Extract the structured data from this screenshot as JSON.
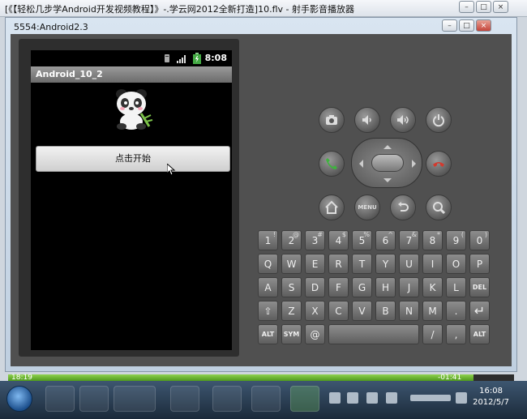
{
  "player": {
    "title": "[《【轻松几步学Android开发视频教程】》-.学云网2012全新打造]10.flv - 射手影音播放器",
    "elapsed": "18:19",
    "remaining": "-01:41",
    "progress": 0.92
  },
  "emulator": {
    "window_title": "5554:Android2.3"
  },
  "device": {
    "clock": "8:08",
    "app_title": "Android_10_2",
    "start_button_label": "点击开始"
  },
  "hardware_buttons": {
    "menu_label": "MENU"
  },
  "keyboard": {
    "rows": [
      [
        {
          "k": "Q",
          "a": "1"
        },
        {
          "k": "W",
          "a": "2"
        },
        {
          "k": "E",
          "a": "3"
        },
        {
          "k": "R",
          "a": "4"
        },
        {
          "k": "T",
          "a": "5"
        },
        {
          "k": "Y",
          "a": "6"
        },
        {
          "k": "U",
          "a": "7"
        },
        {
          "k": "I",
          "a": "8"
        },
        {
          "k": "O",
          "a": "9"
        },
        {
          "k": "P",
          "a": "0"
        }
      ],
      [
        {
          "k": "A",
          "a": ""
        },
        {
          "k": "S",
          "a": ""
        },
        {
          "k": "D",
          "a": ""
        },
        {
          "k": "F",
          "a": ""
        },
        {
          "k": "G",
          "a": ""
        },
        {
          "k": "H",
          "a": ""
        },
        {
          "k": "J",
          "a": ""
        },
        {
          "k": "K",
          "a": ""
        },
        {
          "k": "L",
          "a": ""
        },
        {
          "k": "DEL",
          "a": ""
        }
      ],
      [
        {
          "k": "⇧",
          "a": ""
        },
        {
          "k": "Z",
          "a": ""
        },
        {
          "k": "X",
          "a": ""
        },
        {
          "k": "C",
          "a": ""
        },
        {
          "k": "V",
          "a": ""
        },
        {
          "k": "B",
          "a": ""
        },
        {
          "k": "N",
          "a": ""
        },
        {
          "k": "M",
          "a": ""
        },
        {
          "k": ".",
          "a": ""
        },
        {
          "k": "↵",
          "a": ""
        }
      ],
      [
        {
          "k": "ALT",
          "a": ""
        },
        {
          "k": "SYM",
          "a": ""
        },
        {
          "k": "@",
          "a": ""
        },
        {
          "k": " ",
          "a": ""
        },
        {
          "k": "/",
          "a": ""
        },
        {
          "k": ",",
          "a": ""
        },
        {
          "k": "ALT",
          "a": ""
        }
      ]
    ],
    "top_symbols": [
      "!",
      "@",
      "#",
      "$",
      "%",
      "^",
      "&",
      "*",
      "(",
      ")"
    ]
  },
  "taskbar": {
    "time": "16:08",
    "date": "2012/5/7"
  },
  "colors": {
    "progress": "#6cbf2f",
    "screen": "#000000",
    "emulator_body": "#505050"
  }
}
